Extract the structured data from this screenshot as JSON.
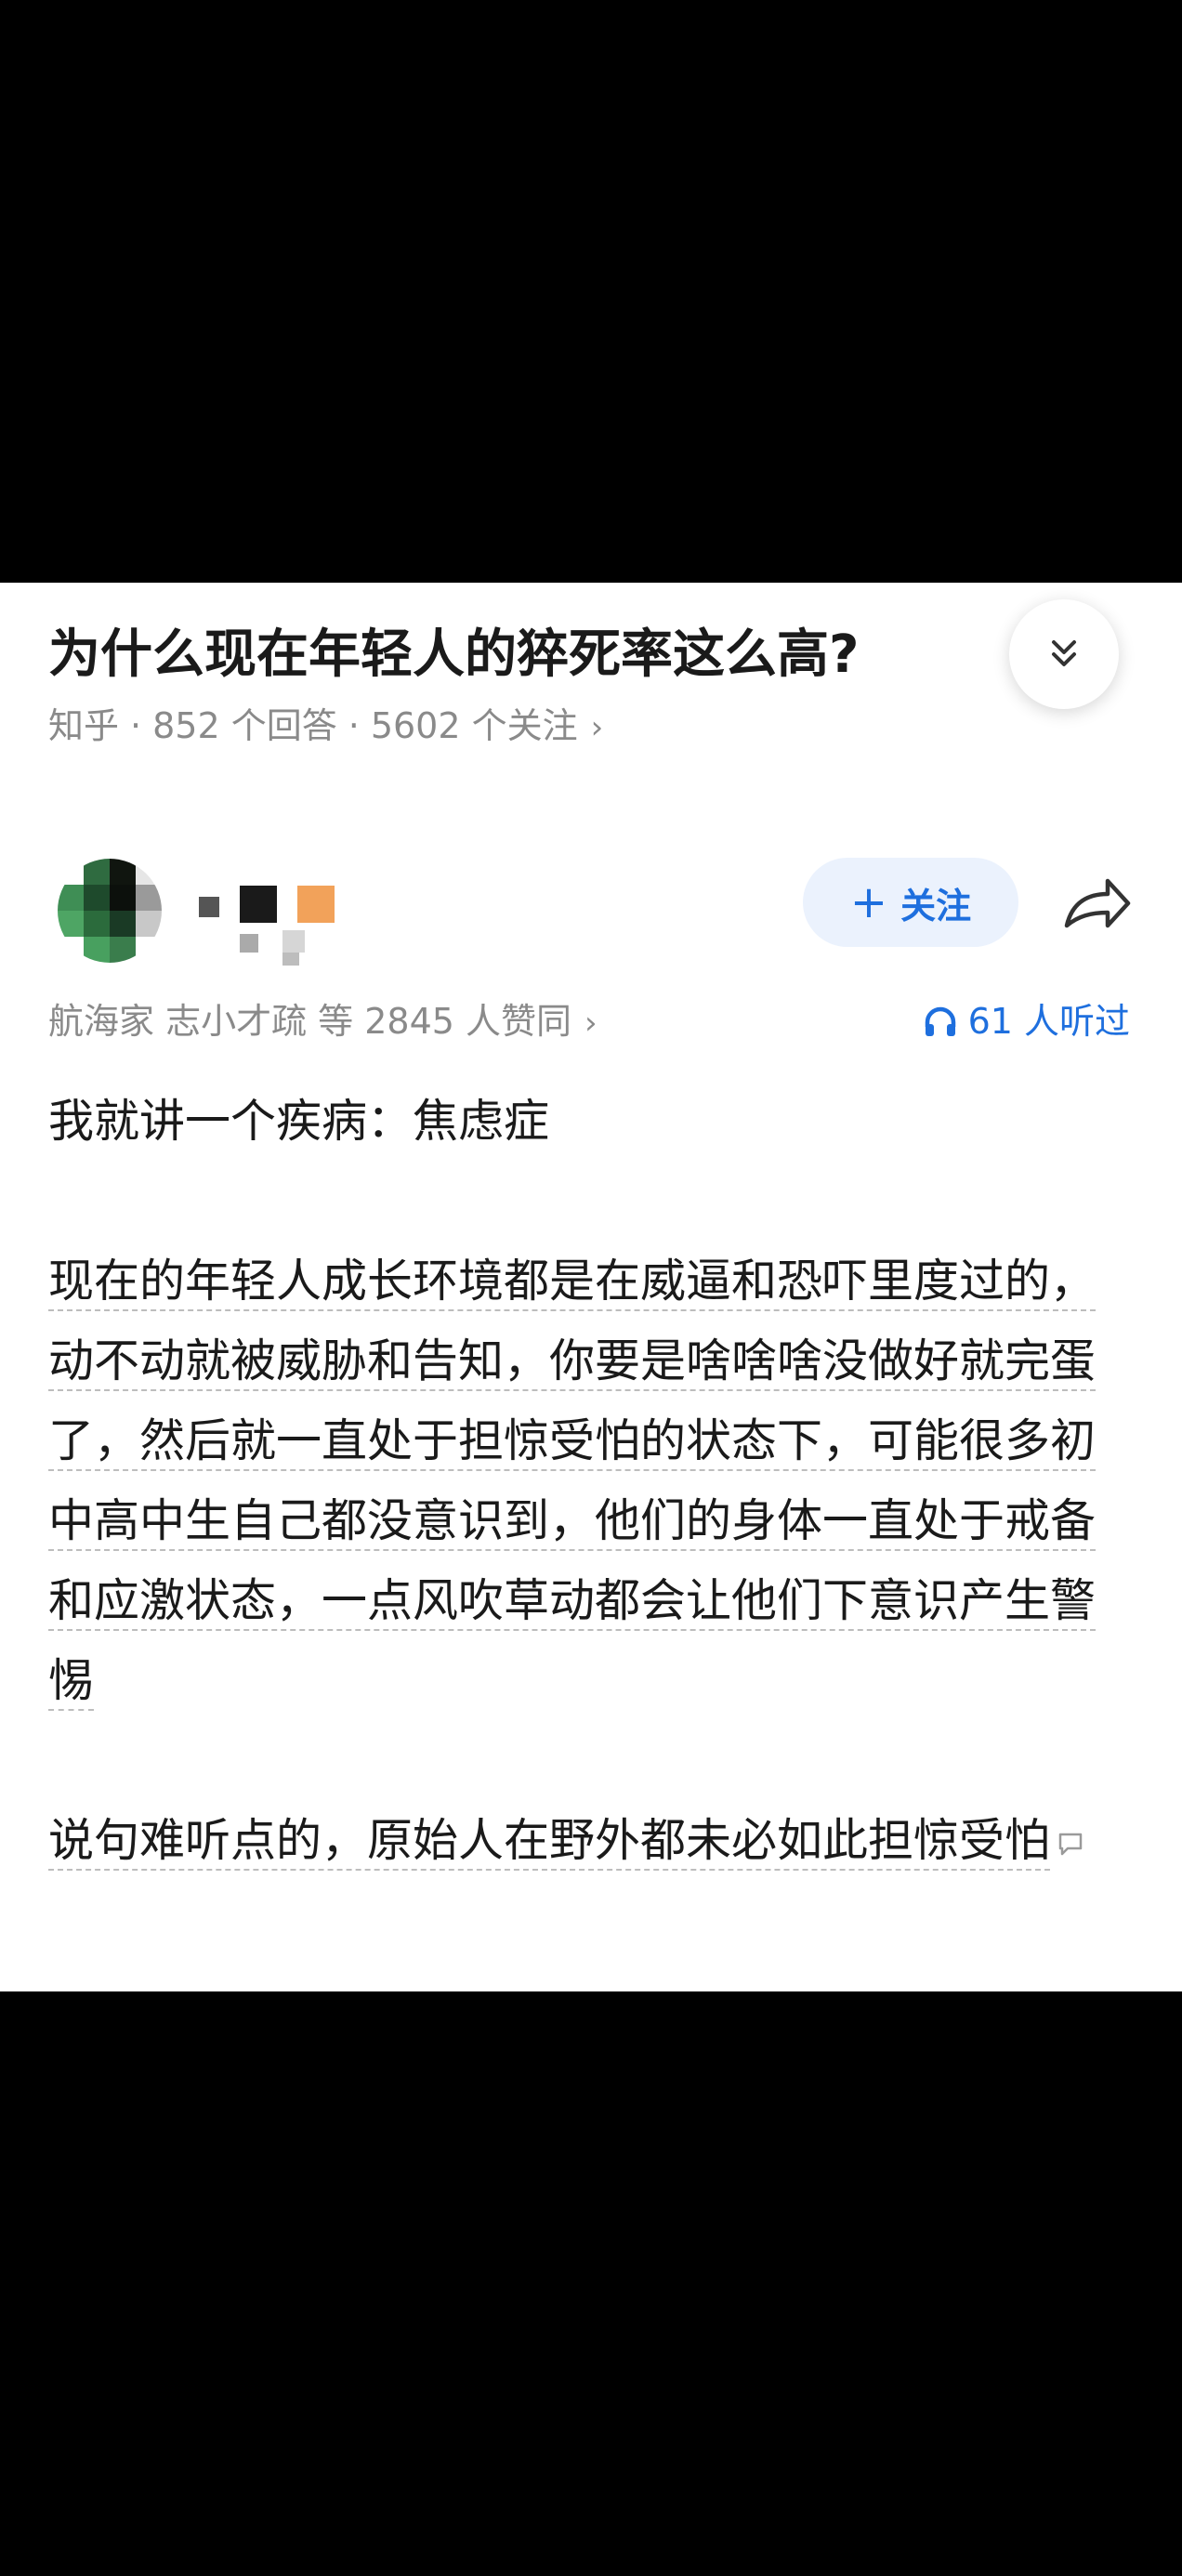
{
  "question": {
    "title": "为什么现在年轻人的猝死率这么高?",
    "source": "知乎",
    "answers_count": "852 个回答",
    "followers_count": "5602 个关注",
    "more_chevron": "›"
  },
  "answer": {
    "follow_label": "关注",
    "upvote_text": "航海家 志小才疏 等 2845 人赞同",
    "upvote_chevron": "›",
    "listened_text": "61 人听过",
    "paragraphs": [
      "我就讲一个疾病：焦虑症",
      "现在的年轻人成长环境都是在威逼和恐吓里度过的，动不动就被威胁和告知，你要是啥啥啥没做好就完蛋了，然后就一直处于担惊受怕的状态下，可能很多初中高中生自己都没意识到，他们的身体一直处于戒备和应激状态，一点风吹草动都会让他们下意识产生警惕",
      "说句难听点的，原始人在野外都未必如此担惊受怕"
    ]
  },
  "colors": {
    "accent": "#1e6fde",
    "follow_bg": "#ebf2fd",
    "meta_gray": "#8a8a8a",
    "text": "#1a1a1a"
  },
  "icons": {
    "collapse": "double-chevron-down-icon",
    "share": "share-arrow-icon",
    "headphone": "headphone-icon",
    "comment": "comment-bubble-icon"
  }
}
